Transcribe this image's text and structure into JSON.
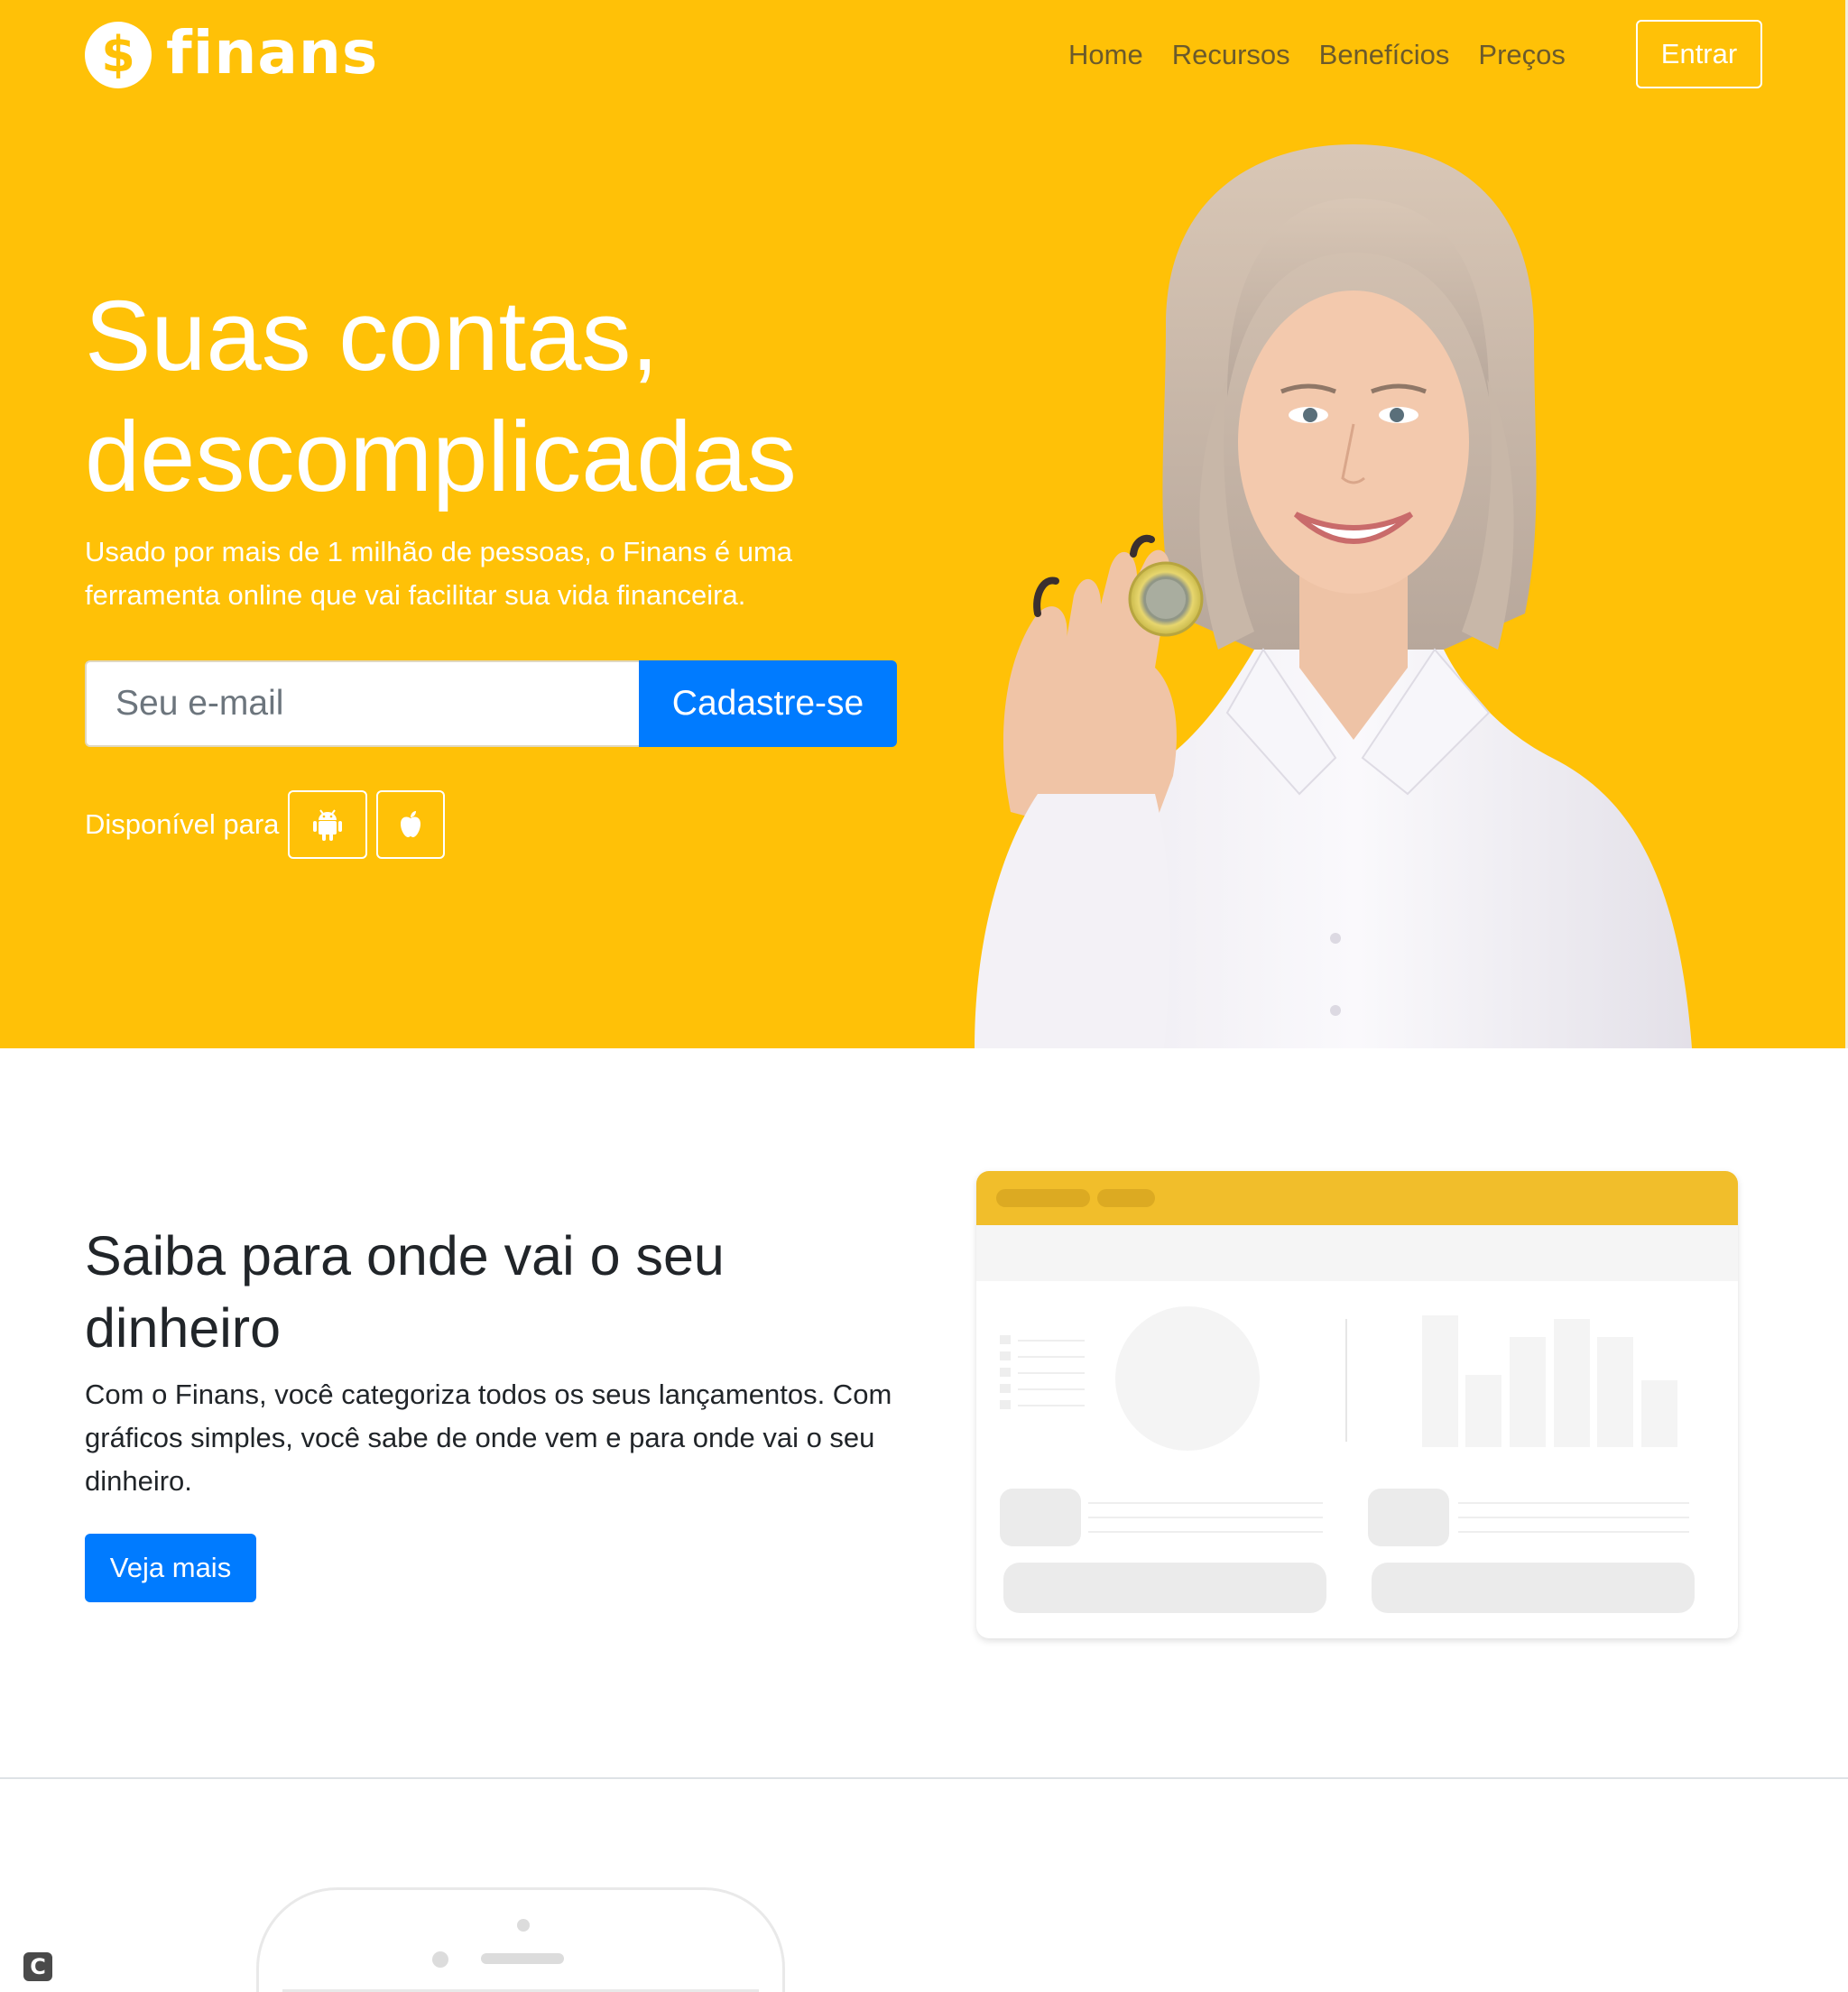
{
  "brand": {
    "icon_glyph": "$",
    "name": "finans",
    "icon_name": "dollar-coin-icon"
  },
  "nav": {
    "items": [
      "Home",
      "Recursos",
      "Benefícios",
      "Preços"
    ],
    "login_label": "Entrar"
  },
  "hero": {
    "title_line1": "Suas contas,",
    "title_line2": "descomplicadas",
    "subtitle": "Usado por mais de 1 milhão de pessoas, o Finans é uma ferramenta online que vai facilitar sua vida financeira.",
    "email_placeholder": "Seu e-mail",
    "signup_label": "Cadastre-se",
    "available_label": "Disponível para",
    "stores": [
      "android-icon",
      "apple-icon"
    ]
  },
  "section2": {
    "title": "Saiba para onde vai o seu dinheiro",
    "text": "Com o Finans, você categoriza todos os seus lançamentos. Com gráficos simples, você sabe de onde vem e para onde vai o seu dinheiro.",
    "button_label": "Veja mais"
  },
  "corner_badge": {
    "glyph": "C"
  },
  "colors": {
    "hero_bg": "#ffc107",
    "primary": "#007bff",
    "dash_header": "#f1be2b"
  }
}
